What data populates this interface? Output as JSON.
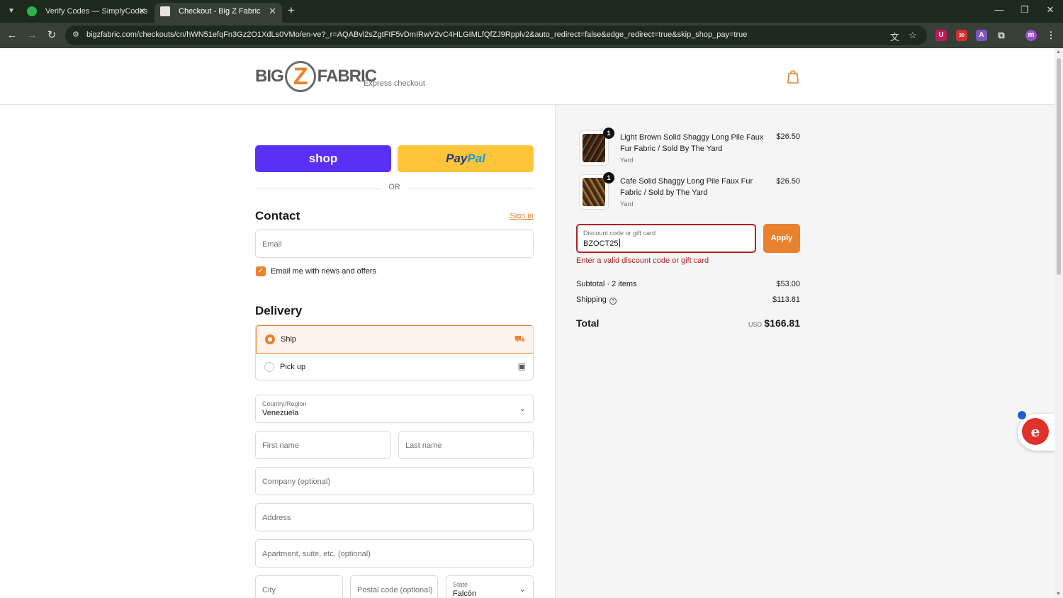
{
  "browser": {
    "tabs": [
      {
        "title": "Verify Codes — SimplyCodes",
        "active": false
      },
      {
        "title": "Checkout - Big Z Fabric",
        "active": true
      }
    ],
    "url": "bigzfabric.com/checkouts/cn/hWN51efqFn3Gz2O1XdLs0VMo/en-ve?_r=AQABvl2sZgtFtF5vDmIRwV2vC4HLGIMLfQfZJ9Rpplv2&auto_redirect=false&edge_redirect=true&skip_shop_pay=true",
    "extension_badge": "30",
    "profile_initial": "m"
  },
  "store": {
    "logo_left": "BIG",
    "logo_mid": "Z",
    "logo_right": "FABRIC"
  },
  "express": {
    "label": "Express checkout",
    "shop_label": "shop",
    "paypal_pay": "Pay",
    "paypal_pal": "Pal",
    "or": "OR"
  },
  "contact": {
    "title": "Contact",
    "signin": "Sign in",
    "email_placeholder": "Email",
    "newsletter_label": "Email me with news and offers",
    "newsletter_checked": true
  },
  "delivery": {
    "title": "Delivery",
    "options": [
      {
        "label": "Ship",
        "selected": true
      },
      {
        "label": "Pick up",
        "selected": false
      }
    ],
    "country_label": "Country/Region",
    "country_value": "Venezuela",
    "first_name": "First name",
    "last_name": "Last name",
    "company": "Company (optional)",
    "address": "Address",
    "apartment": "Apartment, suite, etc. (optional)",
    "city": "City",
    "postal": "Postal code (optional)",
    "state_label": "State",
    "state_value": "Falcón"
  },
  "cart": {
    "items": [
      {
        "qty": "1",
        "name": "Light Brown Solid Shaggy Long Pile Faux Fur Fabric / Sold By The Yard",
        "variant": "Yard",
        "price": "$26.50"
      },
      {
        "qty": "1",
        "name": "Cafe Solid Shaggy Long Pile Faux Fur Fabric / Sold by The Yard",
        "variant": "Yard",
        "price": "$26.50"
      }
    ],
    "discount_label": "Discount code or gift card",
    "discount_value": "BZOCT25",
    "apply_label": "Apply",
    "error": "Enter a valid discount code or gift card",
    "subtotal_label": "Subtotal · 2 items",
    "subtotal_value": "$53.00",
    "shipping_label": "Shipping",
    "shipping_value": "$113.81",
    "total_label": "Total",
    "total_currency": "USD",
    "total_value": "$166.81"
  },
  "colors": {
    "accent": "#e8822e",
    "error": "#b22222",
    "shop": "#5a31f4",
    "paypal": "#ffc439"
  }
}
